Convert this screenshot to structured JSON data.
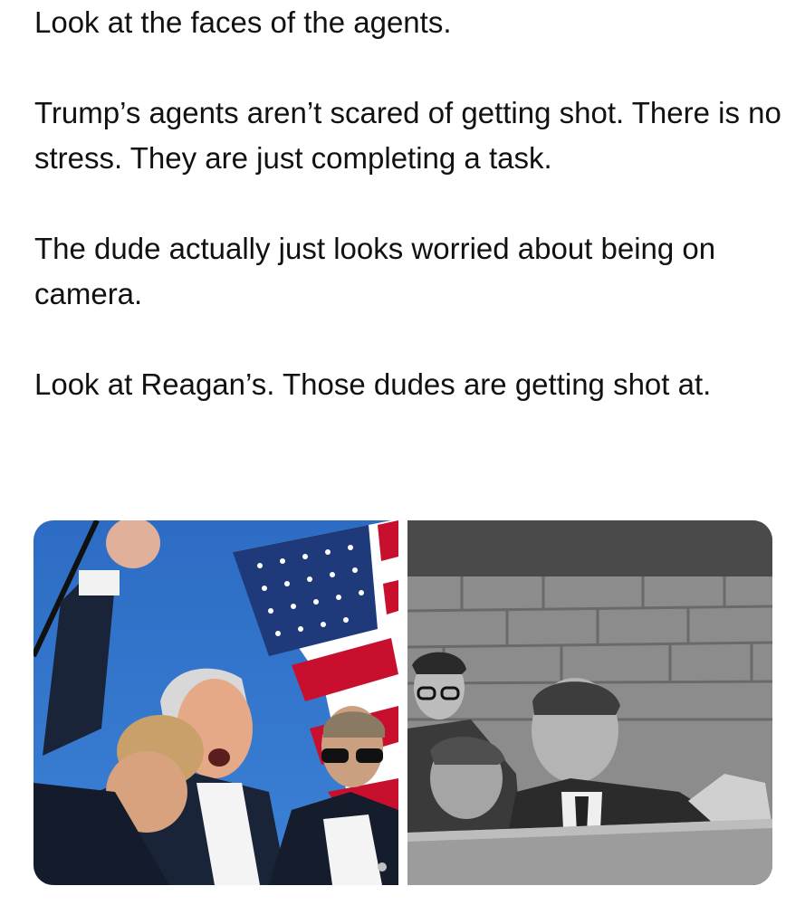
{
  "post": {
    "paragraphs": [
      "Look at the faces of the agents.",
      "Trump’s agents aren’t scared of getting shot. There is no stress. They are just completing a task.",
      "The dude actually just looks worried about being on camera.",
      "Look at Reagan’s. Those dudes are getting shot at."
    ]
  },
  "media": {
    "images": [
      {
        "name": "left-photo",
        "tone": "color"
      },
      {
        "name": "right-photo",
        "tone": "black-and-white"
      }
    ]
  },
  "colors": {
    "text": "#111111",
    "sky": "#2f6fc4",
    "flag_red": "#c8102e",
    "flag_blue": "#1f3a7a"
  }
}
